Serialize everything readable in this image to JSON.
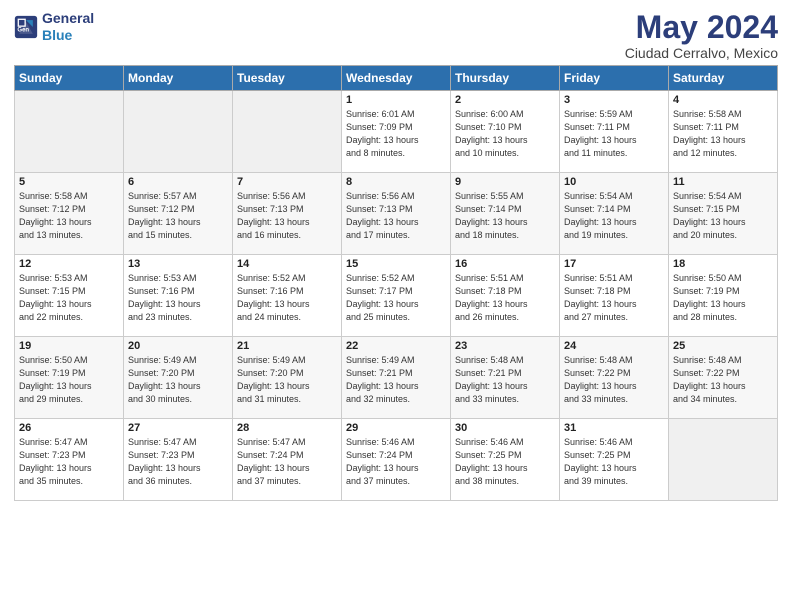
{
  "logo": {
    "line1": "General",
    "line2": "Blue"
  },
  "title": "May 2024",
  "location": "Ciudad Cerralvo, Mexico",
  "weekdays": [
    "Sunday",
    "Monday",
    "Tuesday",
    "Wednesday",
    "Thursday",
    "Friday",
    "Saturday"
  ],
  "weeks": [
    [
      {
        "day": "",
        "detail": ""
      },
      {
        "day": "",
        "detail": ""
      },
      {
        "day": "",
        "detail": ""
      },
      {
        "day": "1",
        "detail": "Sunrise: 6:01 AM\nSunset: 7:09 PM\nDaylight: 13 hours\nand 8 minutes."
      },
      {
        "day": "2",
        "detail": "Sunrise: 6:00 AM\nSunset: 7:10 PM\nDaylight: 13 hours\nand 10 minutes."
      },
      {
        "day": "3",
        "detail": "Sunrise: 5:59 AM\nSunset: 7:11 PM\nDaylight: 13 hours\nand 11 minutes."
      },
      {
        "day": "4",
        "detail": "Sunrise: 5:58 AM\nSunset: 7:11 PM\nDaylight: 13 hours\nand 12 minutes."
      }
    ],
    [
      {
        "day": "5",
        "detail": "Sunrise: 5:58 AM\nSunset: 7:12 PM\nDaylight: 13 hours\nand 13 minutes."
      },
      {
        "day": "6",
        "detail": "Sunrise: 5:57 AM\nSunset: 7:12 PM\nDaylight: 13 hours\nand 15 minutes."
      },
      {
        "day": "7",
        "detail": "Sunrise: 5:56 AM\nSunset: 7:13 PM\nDaylight: 13 hours\nand 16 minutes."
      },
      {
        "day": "8",
        "detail": "Sunrise: 5:56 AM\nSunset: 7:13 PM\nDaylight: 13 hours\nand 17 minutes."
      },
      {
        "day": "9",
        "detail": "Sunrise: 5:55 AM\nSunset: 7:14 PM\nDaylight: 13 hours\nand 18 minutes."
      },
      {
        "day": "10",
        "detail": "Sunrise: 5:54 AM\nSunset: 7:14 PM\nDaylight: 13 hours\nand 19 minutes."
      },
      {
        "day": "11",
        "detail": "Sunrise: 5:54 AM\nSunset: 7:15 PM\nDaylight: 13 hours\nand 20 minutes."
      }
    ],
    [
      {
        "day": "12",
        "detail": "Sunrise: 5:53 AM\nSunset: 7:15 PM\nDaylight: 13 hours\nand 22 minutes."
      },
      {
        "day": "13",
        "detail": "Sunrise: 5:53 AM\nSunset: 7:16 PM\nDaylight: 13 hours\nand 23 minutes."
      },
      {
        "day": "14",
        "detail": "Sunrise: 5:52 AM\nSunset: 7:16 PM\nDaylight: 13 hours\nand 24 minutes."
      },
      {
        "day": "15",
        "detail": "Sunrise: 5:52 AM\nSunset: 7:17 PM\nDaylight: 13 hours\nand 25 minutes."
      },
      {
        "day": "16",
        "detail": "Sunrise: 5:51 AM\nSunset: 7:18 PM\nDaylight: 13 hours\nand 26 minutes."
      },
      {
        "day": "17",
        "detail": "Sunrise: 5:51 AM\nSunset: 7:18 PM\nDaylight: 13 hours\nand 27 minutes."
      },
      {
        "day": "18",
        "detail": "Sunrise: 5:50 AM\nSunset: 7:19 PM\nDaylight: 13 hours\nand 28 minutes."
      }
    ],
    [
      {
        "day": "19",
        "detail": "Sunrise: 5:50 AM\nSunset: 7:19 PM\nDaylight: 13 hours\nand 29 minutes."
      },
      {
        "day": "20",
        "detail": "Sunrise: 5:49 AM\nSunset: 7:20 PM\nDaylight: 13 hours\nand 30 minutes."
      },
      {
        "day": "21",
        "detail": "Sunrise: 5:49 AM\nSunset: 7:20 PM\nDaylight: 13 hours\nand 31 minutes."
      },
      {
        "day": "22",
        "detail": "Sunrise: 5:49 AM\nSunset: 7:21 PM\nDaylight: 13 hours\nand 32 minutes."
      },
      {
        "day": "23",
        "detail": "Sunrise: 5:48 AM\nSunset: 7:21 PM\nDaylight: 13 hours\nand 33 minutes."
      },
      {
        "day": "24",
        "detail": "Sunrise: 5:48 AM\nSunset: 7:22 PM\nDaylight: 13 hours\nand 33 minutes."
      },
      {
        "day": "25",
        "detail": "Sunrise: 5:48 AM\nSunset: 7:22 PM\nDaylight: 13 hours\nand 34 minutes."
      }
    ],
    [
      {
        "day": "26",
        "detail": "Sunrise: 5:47 AM\nSunset: 7:23 PM\nDaylight: 13 hours\nand 35 minutes."
      },
      {
        "day": "27",
        "detail": "Sunrise: 5:47 AM\nSunset: 7:23 PM\nDaylight: 13 hours\nand 36 minutes."
      },
      {
        "day": "28",
        "detail": "Sunrise: 5:47 AM\nSunset: 7:24 PM\nDaylight: 13 hours\nand 37 minutes."
      },
      {
        "day": "29",
        "detail": "Sunrise: 5:46 AM\nSunset: 7:24 PM\nDaylight: 13 hours\nand 37 minutes."
      },
      {
        "day": "30",
        "detail": "Sunrise: 5:46 AM\nSunset: 7:25 PM\nDaylight: 13 hours\nand 38 minutes."
      },
      {
        "day": "31",
        "detail": "Sunrise: 5:46 AM\nSunset: 7:25 PM\nDaylight: 13 hours\nand 39 minutes."
      },
      {
        "day": "",
        "detail": ""
      }
    ]
  ]
}
